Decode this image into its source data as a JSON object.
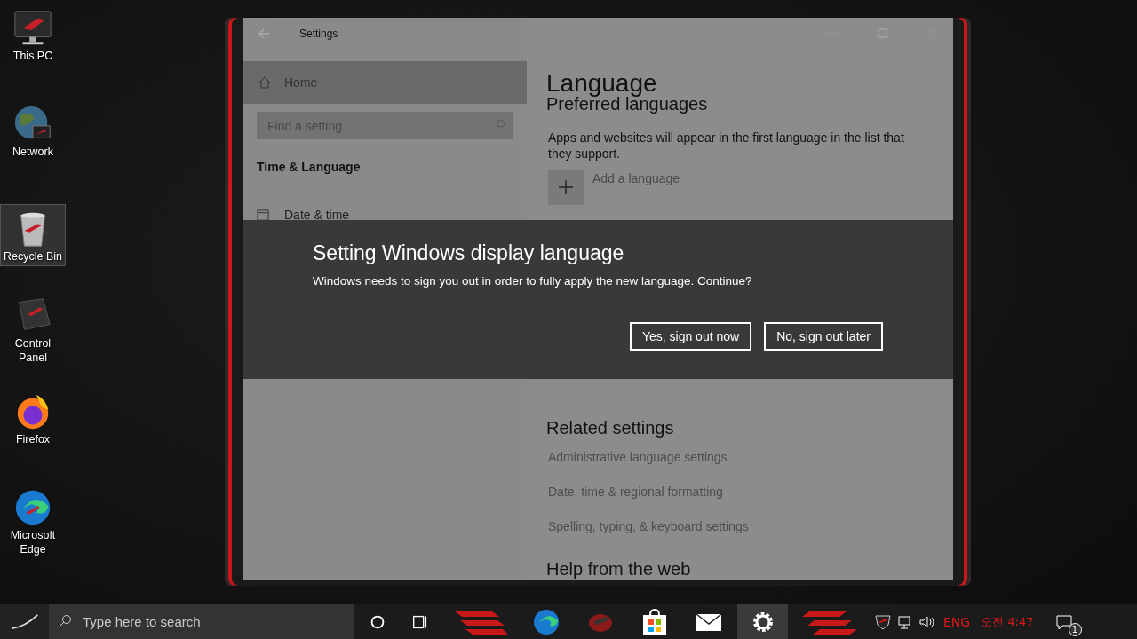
{
  "desktop_icons": [
    {
      "label": "This PC",
      "kind": "monitor",
      "selected": false
    },
    {
      "label": "Network",
      "kind": "globe",
      "selected": false
    },
    {
      "label": "Recycle Bin",
      "kind": "bin",
      "selected": true
    },
    {
      "label": "Control Panel",
      "kind": "laptop",
      "selected": false
    },
    {
      "label": "Firefox",
      "kind": "firefox",
      "selected": false
    },
    {
      "label": "Microsoft Edge",
      "kind": "edge",
      "selected": false
    }
  ],
  "settings_window": {
    "title": "Settings",
    "nav": {
      "home": "Home",
      "search_placeholder": "Find a setting",
      "section": "Time & Language",
      "items": [
        "Date & time"
      ]
    },
    "content": {
      "title": "Language",
      "subtitle": "Preferred languages",
      "description": "Apps and websites will appear in the first language in the list that they support.",
      "add_language": "Add a language",
      "related_title": "Related settings",
      "related_links": [
        "Administrative language settings",
        "Date, time & regional formatting",
        "Spelling, typing, & keyboard settings"
      ],
      "help_title": "Help from the web"
    }
  },
  "dialog": {
    "title": "Setting Windows display language",
    "message": "Windows needs to sign you out in order to fully apply the new language. Continue?",
    "buttons": [
      "Yes, sign out now",
      "No, sign out later"
    ]
  },
  "taskbar": {
    "search_placeholder": "Type here to search",
    "apps": [
      {
        "kind": "edge",
        "selected": false
      },
      {
        "kind": "rog",
        "selected": false
      },
      {
        "kind": "store",
        "selected": false
      },
      {
        "kind": "mail",
        "selected": false
      },
      {
        "kind": "gear",
        "selected": true
      }
    ],
    "language": "ENG",
    "time": "오전 4:47",
    "notification_count": "1"
  }
}
